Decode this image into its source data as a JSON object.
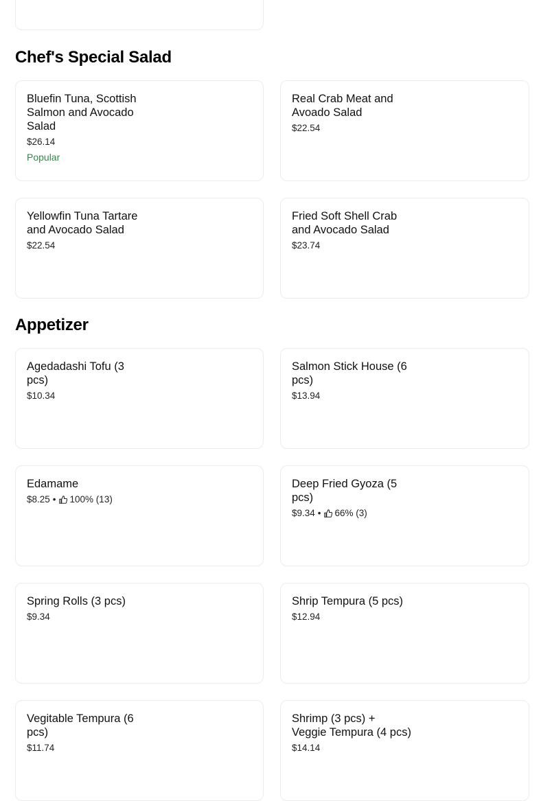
{
  "sections": [
    {
      "title": "Chef's Special Salad",
      "items": [
        {
          "name": "Bluefin Tuna, Scottish Salmon and  Avocado Salad",
          "price": "$26.14",
          "badge": "Popular"
        },
        {
          "name": "Real Crab Meat and Avoado Salad",
          "price": "$22.54"
        },
        {
          "name": "Yellowfin Tuna Tartare and Avocado Salad",
          "price": "$22.54"
        },
        {
          "name": "Fried Soft Shell Crab and Avocado Salad",
          "price": "$23.74"
        }
      ]
    },
    {
      "title": "Appetizer",
      "items": [
        {
          "name": "Agedadashi Tofu (3 pcs)",
          "price": "$10.34"
        },
        {
          "name": "Salmon Stick House (6 pcs)",
          "price": "$13.94"
        },
        {
          "name": "Edamame",
          "price": "$8.25",
          "rating": "100% (13)"
        },
        {
          "name": "Deep Fried Gyoza (5 pcs)",
          "price": "$9.34",
          "rating": "66% (3)"
        },
        {
          "name": "Spring Rolls (3 pcs)",
          "price": "$9.34"
        },
        {
          "name": "Shrip Tempura (5 pcs)",
          "price": "$12.94"
        },
        {
          "name": "Vegitable Tempura (6 pcs)",
          "price": "$11.74"
        },
        {
          "name": "Shrimp (3 pcs) + Veggie Tempura (4 pcs)",
          "price": "$14.14"
        }
      ]
    }
  ],
  "separator": "•",
  "colors": {
    "popular": "#2e8b47",
    "border": "#ececec"
  },
  "icons": {
    "rating": "thumbs-up-icon"
  }
}
